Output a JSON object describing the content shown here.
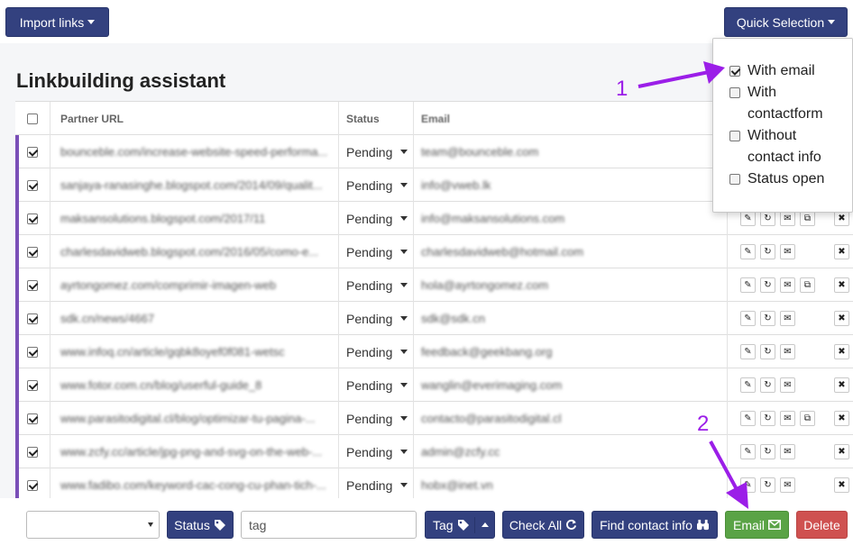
{
  "toolbar": {
    "import_label": "Import links",
    "quick_label": "Quick Selection"
  },
  "page_title": "Linkbuilding assistant",
  "table": {
    "headers": {
      "partner_url": "Partner URL",
      "status": "Status",
      "email": "Email"
    },
    "rows": [
      {
        "url": "bounceble.com/increase-website-speed-performa...",
        "status": "Pending",
        "email": "team@bounceble.com",
        "checked": true,
        "copy_icon": false
      },
      {
        "url": "sanjaya-ranasinghe.blogspot.com/2014/09/qualit...",
        "status": "Pending",
        "email": "info@vweb.lk",
        "checked": true,
        "copy_icon": false
      },
      {
        "url": "maksansolutions.blogspot.com/2017/11",
        "status": "Pending",
        "email": "info@maksansolutions.com",
        "checked": true,
        "copy_icon": true
      },
      {
        "url": "charlesdavidweb.blogspot.com/2016/05/como-e...",
        "status": "Pending",
        "email": "charlesdavidweb@hotmail.com",
        "checked": true,
        "copy_icon": false
      },
      {
        "url": "ayrtongomez.com/comprimir-imagen-web",
        "status": "Pending",
        "email": "hola@ayrtongomez.com",
        "checked": true,
        "copy_icon": true
      },
      {
        "url": "sdk.cn/news/4667",
        "status": "Pending",
        "email": "sdk@sdk.cn",
        "checked": true,
        "copy_icon": false
      },
      {
        "url": "www.infoq.cn/article/gqbk8oyef0f081-wetsc",
        "status": "Pending",
        "email": "feedback@geekbang.org",
        "checked": true,
        "copy_icon": false
      },
      {
        "url": "www.fotor.com.cn/blog/userful-guide_8",
        "status": "Pending",
        "email": "wanglin@everimaging.com",
        "checked": true,
        "copy_icon": false
      },
      {
        "url": "www.parasitodigital.cl/blog/optimizar-tu-pagina-...",
        "status": "Pending",
        "email": "contacto@parasitodigital.cl",
        "checked": true,
        "copy_icon": true
      },
      {
        "url": "www.zcfy.cc/article/jpg-png-and-svg-on-the-web-...",
        "status": "Pending",
        "email": "admin@zcfy.cc",
        "checked": true,
        "copy_icon": false
      },
      {
        "url": "www.fadibo.com/keyword-cac-cong-cu-phan-tich-...",
        "status": "Pending",
        "email": "hobx@inet.vn",
        "checked": true,
        "copy_icon": false
      }
    ]
  },
  "quick_selection": {
    "items": [
      {
        "label": "With email",
        "checked": true
      },
      {
        "label": "With contactform",
        "checked": false
      },
      {
        "label": "Without contact info",
        "checked": false
      },
      {
        "label": "Status open",
        "checked": false
      }
    ]
  },
  "bottom": {
    "select_value": "",
    "status_label": "Status",
    "tag_placeholder": "tag",
    "tag_label": "Tag",
    "check_all_label": "Check All",
    "find_contact_label": "Find contact info",
    "email_label": "Email",
    "delete_label": "Delete"
  },
  "annotations": {
    "one": "1",
    "two": "2"
  },
  "colors": {
    "navy": "#33417f",
    "green": "#5aa346",
    "red": "#cf5150",
    "accent": "#7a4fb8",
    "annotation": "#9b1ee8"
  }
}
